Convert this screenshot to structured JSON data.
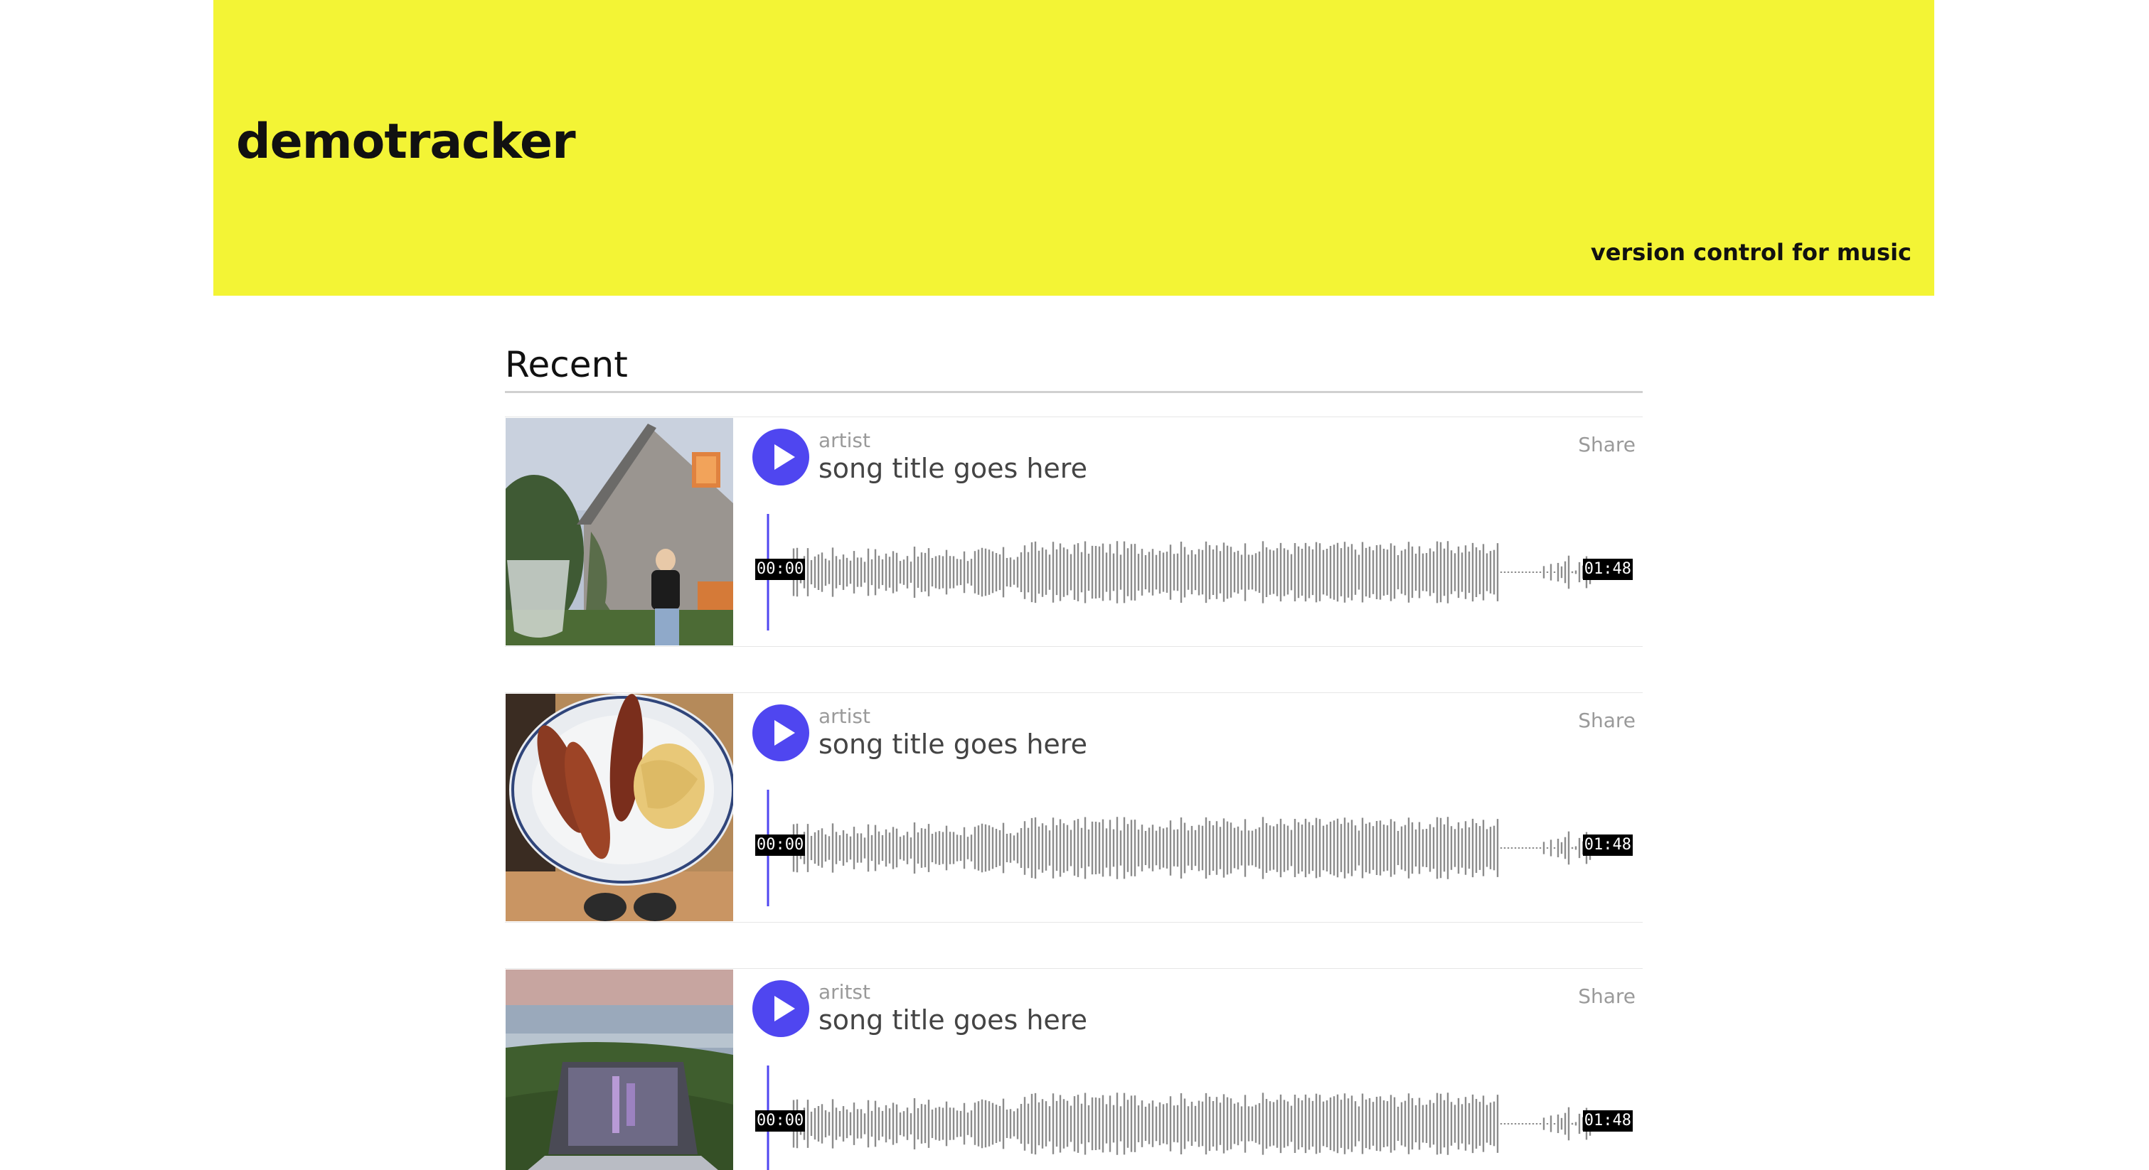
{
  "header": {
    "brand": "demotracker",
    "tagline": "version control for music",
    "background": "#f3f435"
  },
  "recent": {
    "title": "Recent",
    "tracks": [
      {
        "artist": "artist",
        "title": "song title goes here",
        "share_label": "Share",
        "current_time": "00:00",
        "duration": "01:48",
        "thumbnail": "house-garden-photo"
      },
      {
        "artist": "artist",
        "title": "song title goes here",
        "share_label": "Share",
        "current_time": "00:00",
        "duration": "01:48",
        "thumbnail": "hotdog-spaghetti-plate-photo"
      },
      {
        "artist": "aritst",
        "title": "song title goes here",
        "share_label": "Share",
        "current_time": "00:00",
        "duration": "01:48",
        "thumbnail": "laptop-on-grass-photo"
      }
    ]
  },
  "colors": {
    "accent": "#4f46f0",
    "waveform": "#8c8c8c",
    "muted_text": "#9a9a9a"
  },
  "icons": {
    "play": "play-icon"
  }
}
